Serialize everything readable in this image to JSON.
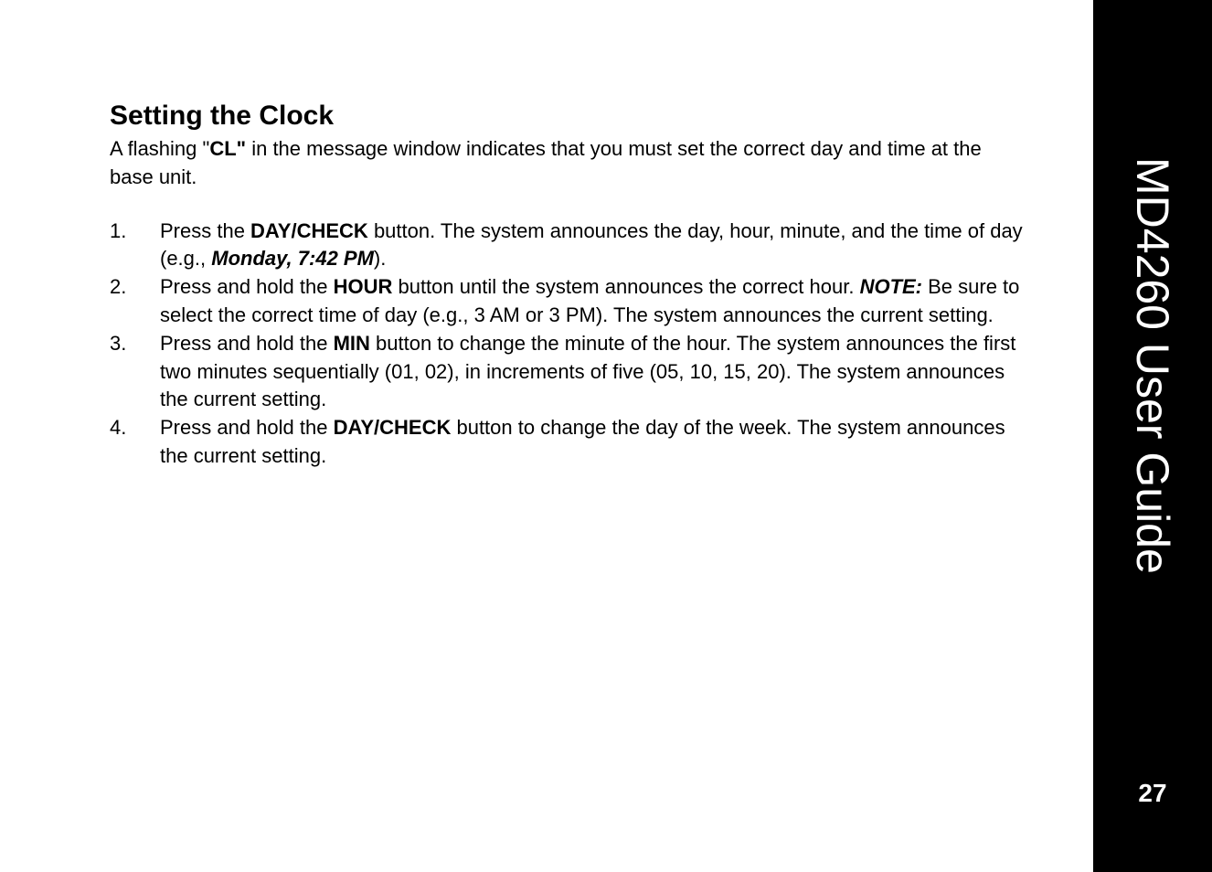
{
  "sidebar": {
    "title": "MD4260 User Guide",
    "pageNumber": "27"
  },
  "heading": "Setting the Clock",
  "intro": {
    "prefix": "A flashing \"",
    "code": "CL\"",
    "suffix": " in the message window indicates that you must set the correct day and time at the base unit."
  },
  "steps": [
    {
      "number": "1.",
      "parts": [
        {
          "text": "Press the ",
          "style": "plain"
        },
        {
          "text": "DAY/CHECK",
          "style": "bold"
        },
        {
          "text": " button. The system announces the day, hour, minute, and the time of day (e.g., ",
          "style": "plain"
        },
        {
          "text": "Monday, 7:42 PM",
          "style": "bold-italic"
        },
        {
          "text": ").",
          "style": "plain"
        }
      ]
    },
    {
      "number": "2.",
      "parts": [
        {
          "text": "Press and hold the ",
          "style": "plain"
        },
        {
          "text": "HOUR",
          "style": "bold"
        },
        {
          "text": " button until the system announces the correct hour. ",
          "style": "plain"
        },
        {
          "text": "NOTE:",
          "style": "bold-italic"
        },
        {
          "text": " Be sure to select the correct time of day (e.g., 3 AM or 3 PM). The system announces the current setting.",
          "style": "plain"
        }
      ]
    },
    {
      "number": "3.",
      "parts": [
        {
          "text": "Press and hold the ",
          "style": "plain"
        },
        {
          "text": "MIN",
          "style": "bold"
        },
        {
          "text": " button to change the minute of the hour. The system announces the first two minutes sequentially (01, 02), in increments of five (05, 10, 15, 20). The system announces the current setting.",
          "style": "plain"
        }
      ]
    },
    {
      "number": "4.",
      "parts": [
        {
          "text": "Press and hold the ",
          "style": "plain"
        },
        {
          "text": "DAY/CHECK",
          "style": "bold"
        },
        {
          "text": " button to change the day of the week. The system announces the current setting.",
          "style": "plain"
        }
      ]
    }
  ]
}
